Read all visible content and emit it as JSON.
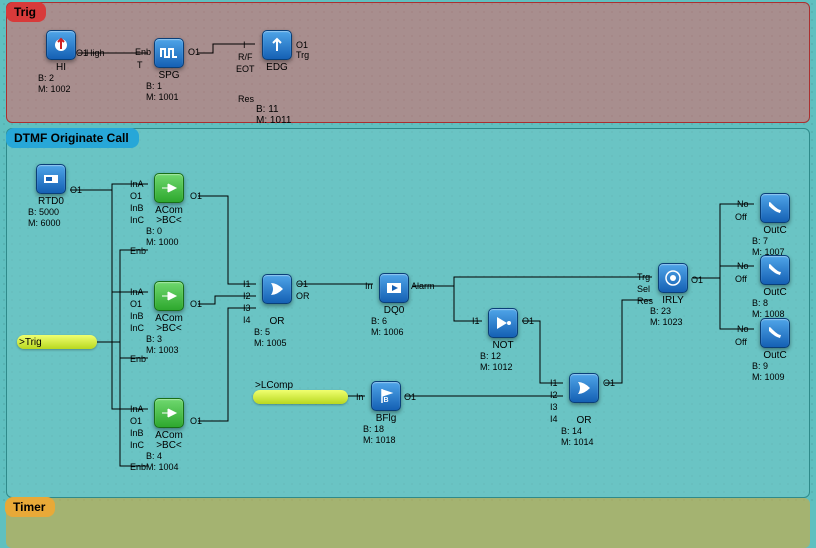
{
  "sections": {
    "trig": "Trig",
    "dtmf": "DTMF Originate Call",
    "timer": "Timer"
  },
  "blocks": {
    "hi": {
      "title": "HI",
      "b": "B: 2",
      "m": "M: 1002"
    },
    "spg": {
      "title": "SPG",
      "b": "B: 1",
      "m": "M: 1001"
    },
    "edg": {
      "title": "EDG",
      "b": "B: 11",
      "m": "M: 1011"
    },
    "rtd": {
      "title": "RTD0",
      "b": "B: 5000",
      "m": "M: 6000"
    },
    "acom1": {
      "title": "ACom",
      "sub": ">BC<",
      "b": "B: 0",
      "m": "M: 1000"
    },
    "acom2": {
      "title": "ACom",
      "sub": ">BC<",
      "b": "B: 3",
      "m": "M: 1003"
    },
    "acom3": {
      "title": "ACom",
      "sub": ">BC<",
      "b": "B: 4",
      "m": "M: 1004"
    },
    "or1": {
      "title": "OR",
      "b": "B: 5",
      "m": "M: 1005"
    },
    "dq0": {
      "title": "DQ0",
      "b": "B: 6",
      "m": "M: 1006"
    },
    "not": {
      "title": "NOT",
      "b": "B: 12",
      "m": "M: 1012"
    },
    "bflg": {
      "title": "BFlg",
      "b": "B: 18",
      "m": "M: 1018"
    },
    "or2": {
      "title": "OR",
      "b": "B: 14",
      "m": "M: 1014"
    },
    "irly": {
      "title": "IRLY",
      "b": "B: 23",
      "m": "M: 1023"
    },
    "outc1": {
      "title": "OutC",
      "b": "B: 7",
      "m": "M: 1007"
    },
    "outc2": {
      "title": "OutC",
      "b": "B: 8",
      "m": "M: 1008"
    },
    "outc3": {
      "title": "OutC",
      "b": "B: 9",
      "m": "M: 1009"
    }
  },
  "ports": {
    "o1": "O1",
    "high": "High",
    "enb": "Enb",
    "t": "T",
    "i": "I",
    "rf": "R/F",
    "eot": "EOT",
    "res": "Res",
    "trg": "Trg",
    "ina": "InA",
    "inb": "InB",
    "inc": "InC",
    "i1": "I1",
    "i2": "I2",
    "i3": "I3",
    "i4": "I4",
    "or": "OR",
    "in": "In",
    "alarm": "Alarm",
    "sel": "Sel",
    "no": "No",
    "off": "Off"
  },
  "stubs": {
    "trig": ">Trig",
    "lcomp": ">LComp"
  }
}
